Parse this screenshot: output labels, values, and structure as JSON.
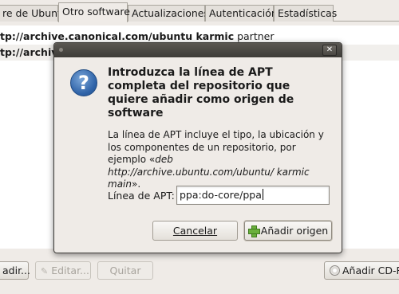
{
  "tabs": [
    {
      "label": "re de Ubuntu"
    },
    {
      "label": "Otro software",
      "active": true
    },
    {
      "label": "Actualizaciones"
    },
    {
      "label": "Autenticación"
    },
    {
      "label": "Estadísticas"
    }
  ],
  "sources": [
    {
      "text_bold": "tp://archive.canonical.com/ubuntu karmic",
      "text_normal": " partner"
    },
    {
      "text_bold": "tp://archive",
      "text_normal": ""
    }
  ],
  "bottom_buttons": {
    "add": "adir...",
    "edit": "Editar...",
    "remove": "Quitar",
    "add_cdrom": "Añadir CD-RC"
  },
  "dialog": {
    "heading": "Introduzca la línea de APT completa del repositorio que quiere añadir como origen de software",
    "desc_plain": "La línea de APT incluye el tipo, la ubicación y los componentes de un repositorio, por ejemplo «",
    "desc_example": "deb http://archive.ubuntu.com/ubuntu/ karmic main",
    "desc_end": "».",
    "apt_label": "Línea de APT:",
    "apt_value": "ppa:do-core/ppa",
    "cancel_label": "Cancelar",
    "add_label": "Añadir origen"
  },
  "icons": {
    "question": "question-icon",
    "close": "close-icon",
    "plus": "add-icon",
    "pencil": "pencil-icon",
    "cd": "cdrom-icon"
  }
}
